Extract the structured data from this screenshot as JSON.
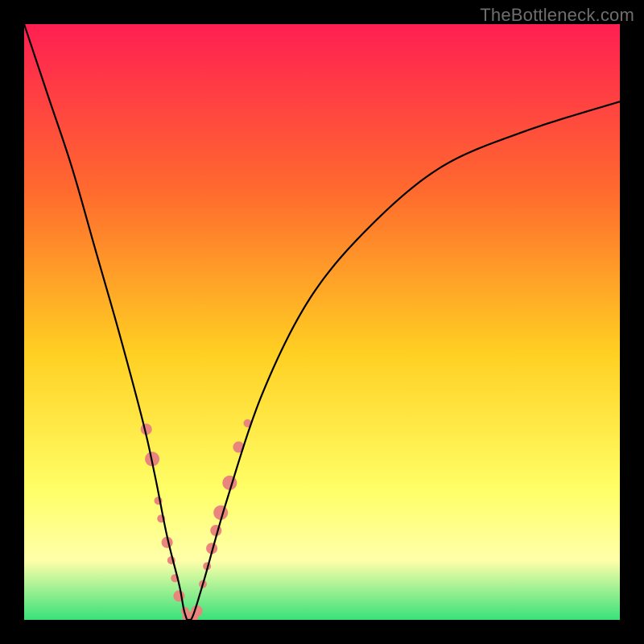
{
  "watermark": "TheBottleneck.com",
  "chart_data": {
    "type": "line",
    "title": "",
    "xlabel": "",
    "ylabel": "",
    "xlim": [
      0,
      100
    ],
    "ylim": [
      0,
      100
    ],
    "grid": false,
    "legend": null,
    "background_gradient": {
      "top": "#ff1f52",
      "mid_upper": "#ff6a2e",
      "mid": "#ffcf22",
      "mid_lower": "#ffff66",
      "band": "#ffffaa",
      "bottom": "#38e17a"
    },
    "frame_color": "#000000",
    "series": [
      {
        "name": "bottleneck-curve",
        "x": [
          0,
          4,
          8,
          12,
          16,
          20,
          22,
          24,
          26,
          27,
          28,
          30,
          34,
          40,
          48,
          58,
          70,
          84,
          100
        ],
        "values": [
          100,
          88,
          76,
          62,
          48,
          33,
          24,
          14,
          6,
          1,
          0,
          6,
          20,
          38,
          54,
          66,
          76,
          82,
          87
        ],
        "stroke": "#000000",
        "stroke_width": 2.2
      }
    ],
    "markers": {
      "color": "#e9857d",
      "radius_small": 5,
      "radius_large": 9,
      "points": [
        {
          "x": 20.5,
          "y": 32,
          "r": 7
        },
        {
          "x": 21.5,
          "y": 27,
          "r": 9
        },
        {
          "x": 22.5,
          "y": 20,
          "r": 5
        },
        {
          "x": 23.0,
          "y": 17,
          "r": 5
        },
        {
          "x": 24.0,
          "y": 13,
          "r": 7
        },
        {
          "x": 24.7,
          "y": 10,
          "r": 5
        },
        {
          "x": 25.3,
          "y": 7,
          "r": 5
        },
        {
          "x": 26.0,
          "y": 4,
          "r": 7
        },
        {
          "x": 27.0,
          "y": 1.5,
          "r": 5
        },
        {
          "x": 27.5,
          "y": 0.5,
          "r": 7
        },
        {
          "x": 28.3,
          "y": 0.5,
          "r": 7
        },
        {
          "x": 29.0,
          "y": 1.5,
          "r": 7
        },
        {
          "x": 30.0,
          "y": 6,
          "r": 5
        },
        {
          "x": 30.7,
          "y": 9,
          "r": 5
        },
        {
          "x": 31.5,
          "y": 12,
          "r": 7
        },
        {
          "x": 32.2,
          "y": 15,
          "r": 7
        },
        {
          "x": 33.0,
          "y": 18,
          "r": 9
        },
        {
          "x": 34.5,
          "y": 23,
          "r": 9
        },
        {
          "x": 36.0,
          "y": 29,
          "r": 7
        },
        {
          "x": 37.5,
          "y": 33,
          "r": 5
        }
      ]
    }
  }
}
